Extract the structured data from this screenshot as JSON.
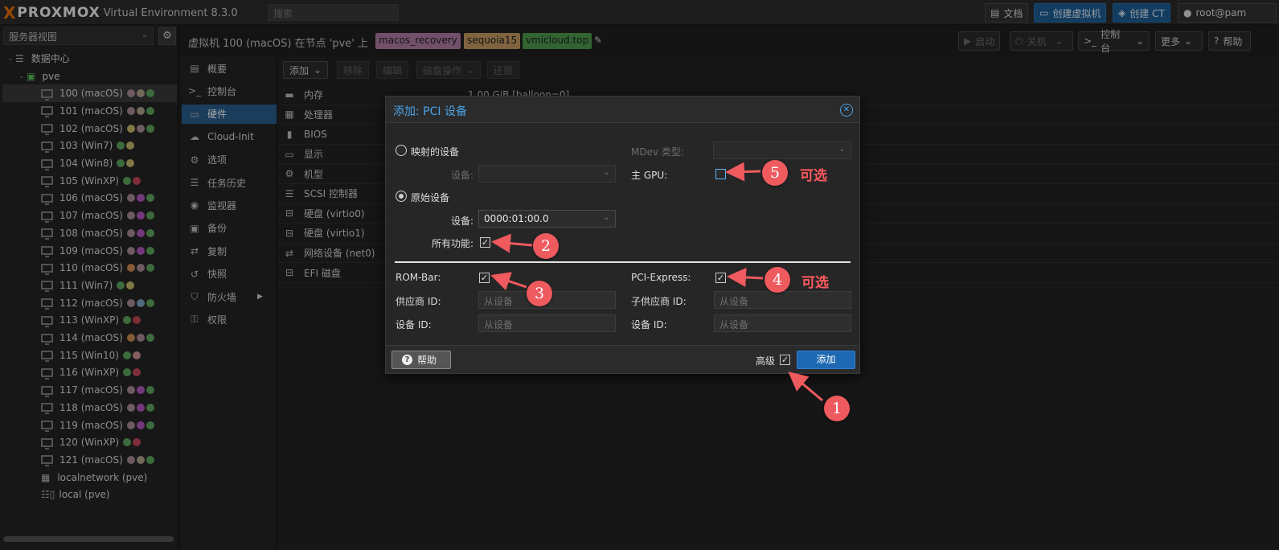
{
  "topbar": {
    "logo_x": "X",
    "logo_text": "PROXMOX",
    "product": "Virtual Environment 8.3.0",
    "search_placeholder": "搜索",
    "docs_label": "文档",
    "create_vm_label": "创建虚拟机",
    "create_ct_label": "创建 CT",
    "user_label": "root@pam"
  },
  "left": {
    "view_select": "服务器视图",
    "datacenter": "数据中心",
    "node": "pve",
    "vms": [
      {
        "label": "100 (macOS)",
        "dots": [
          "#a88a98",
          "#b0a28c",
          "#5fa55f"
        ]
      },
      {
        "label": "101 (macOS)",
        "dots": [
          "#a88a98",
          "#b0a28c",
          "#5fa55f"
        ]
      },
      {
        "label": "102 (macOS)",
        "dots": [
          "#c7b96a",
          "#a88a98",
          "#5fa55f"
        ]
      },
      {
        "label": "103 (Win7)",
        "dots": [
          "#5fa55f",
          "#c7b96a"
        ]
      },
      {
        "label": "104 (Win8)",
        "dots": [
          "#5fa55f",
          "#c7b96a"
        ]
      },
      {
        "label": "105 (WinXP)",
        "dots": [
          "#5fa55f",
          "#c2485a"
        ]
      },
      {
        "label": "106 (macOS)",
        "dots": [
          "#a88a98",
          "#b257c0",
          "#5fa55f"
        ]
      },
      {
        "label": "107 (macOS)",
        "dots": [
          "#a88a98",
          "#b257c0",
          "#5fa55f"
        ]
      },
      {
        "label": "108 (macOS)",
        "dots": [
          "#a88a98",
          "#b257c0",
          "#5fa55f"
        ]
      },
      {
        "label": "109 (macOS)",
        "dots": [
          "#a88a98",
          "#b257c0",
          "#5fa55f"
        ]
      },
      {
        "label": "110 (macOS)",
        "dots": [
          "#c98a4f",
          "#a88a98",
          "#5fa55f"
        ]
      },
      {
        "label": "111 (Win7)",
        "dots": [
          "#5fa55f",
          "#c7b96a"
        ]
      },
      {
        "label": "112 (macOS)",
        "dots": [
          "#a88a98",
          "#7fa3c2",
          "#5fa55f"
        ]
      },
      {
        "label": "113 (WinXP)",
        "dots": [
          "#5fa55f",
          "#c2485a"
        ]
      },
      {
        "label": "114 (macOS)",
        "dots": [
          "#c98a4f",
          "#a88a98",
          "#5fa55f"
        ]
      },
      {
        "label": "115 (Win10)",
        "dots": [
          "#5fa55f",
          "#c99090"
        ]
      },
      {
        "label": "116 (WinXP)",
        "dots": [
          "#5fa55f",
          "#c2485a"
        ]
      },
      {
        "label": "117 (macOS)",
        "dots": [
          "#a88a98",
          "#b257c0",
          "#5fa55f"
        ]
      },
      {
        "label": "118 (macOS)",
        "dots": [
          "#a88a98",
          "#b257c0",
          "#5fa55f"
        ]
      },
      {
        "label": "119 (macOS)",
        "dots": [
          "#a88a98",
          "#b257c0",
          "#5fa55f"
        ]
      },
      {
        "label": "120 (WinXP)",
        "dots": [
          "#5fa55f",
          "#c2485a"
        ]
      },
      {
        "label": "121 (macOS)",
        "dots": [
          "#a88a98",
          "#b0a28c",
          "#5fa55f"
        ]
      }
    ],
    "localnetwork": "localnetwork (pve)",
    "local": "local (pve)"
  },
  "header": {
    "vm_title": "虚拟机 100 (macOS) 在节点 'pve' 上",
    "tags": [
      {
        "label": "macos_recovery",
        "color": "#b07ca3"
      },
      {
        "label": "sequoia15",
        "color": "#c49a62"
      },
      {
        "label": "vmicloud.top",
        "color": "#4e9a4e"
      }
    ],
    "start": "启动",
    "shutdown": "关机",
    "console": "控制台",
    "more": "更多",
    "help": "帮助"
  },
  "midmenu": [
    {
      "label": "概要",
      "icon": "book-icon"
    },
    {
      "label": "控制台",
      "icon": "terminal-icon"
    },
    {
      "label": "硬件",
      "icon": "monitor-icon"
    },
    {
      "label": "Cloud-Init",
      "icon": "cloud-icon"
    },
    {
      "label": "选项",
      "icon": "gear-icon"
    },
    {
      "label": "任务历史",
      "icon": "list-icon"
    },
    {
      "label": "监视器",
      "icon": "eye-icon"
    },
    {
      "label": "备份",
      "icon": "floppy-icon"
    },
    {
      "label": "复制",
      "icon": "retweet-icon"
    },
    {
      "label": "快照",
      "icon": "history-icon"
    },
    {
      "label": "防火墙",
      "icon": "shield-icon"
    },
    {
      "label": "权限",
      "icon": "unlock-icon"
    }
  ],
  "hwtoolbar": {
    "add": "添加",
    "remove": "移除",
    "edit": "编辑",
    "disk_action": "磁盘操作",
    "revert": "还原"
  },
  "hardware": [
    {
      "label": "内存",
      "value": "1.00 GiB [balloon=0]",
      "icon": "memory-icon"
    },
    {
      "label": "处理器",
      "value": "",
      "icon": "cpu-icon"
    },
    {
      "label": "BIOS",
      "value": "",
      "icon": "bios-icon"
    },
    {
      "label": "显示",
      "value": "",
      "icon": "display-icon"
    },
    {
      "label": "机型",
      "value": "",
      "icon": "cogs-icon"
    },
    {
      "label": "SCSI 控制器",
      "value": "",
      "icon": "database-icon"
    },
    {
      "label": "硬盘 (virtio0)",
      "value": "",
      "icon": "hdd-icon"
    },
    {
      "label": "硬盘 (virtio1)",
      "value": "",
      "icon": "hdd-icon"
    },
    {
      "label": "网络设备 (net0)",
      "value": "",
      "icon": "exchange-icon"
    },
    {
      "label": "EFI 磁盘",
      "value": "",
      "icon": "hdd-icon"
    }
  ],
  "modal": {
    "title": "添加: PCI 设备",
    "mapped_device": "映射的设备",
    "device_label": "设备:",
    "mdev_label": "MDev 类型:",
    "primary_gpu": "主 GPU:",
    "raw_device": "原始设备",
    "device_value": "0000:01:00.0",
    "all_functions": "所有功能:",
    "rom_bar": "ROM-Bar:",
    "pcie": "PCI-Express:",
    "vendor_id": "供应商 ID:",
    "sub_vendor_id": "子供应商 ID:",
    "device_id": "设备 ID:",
    "sub_device_id": "设备 ID:",
    "from_device": "从设备",
    "help": "帮助",
    "advanced": "高级",
    "add": "添加",
    "check": "✓"
  },
  "annotations": {
    "n1": "1",
    "n2": "2",
    "n3": "3",
    "n4": "4",
    "n5": "5",
    "optional": "可选"
  }
}
